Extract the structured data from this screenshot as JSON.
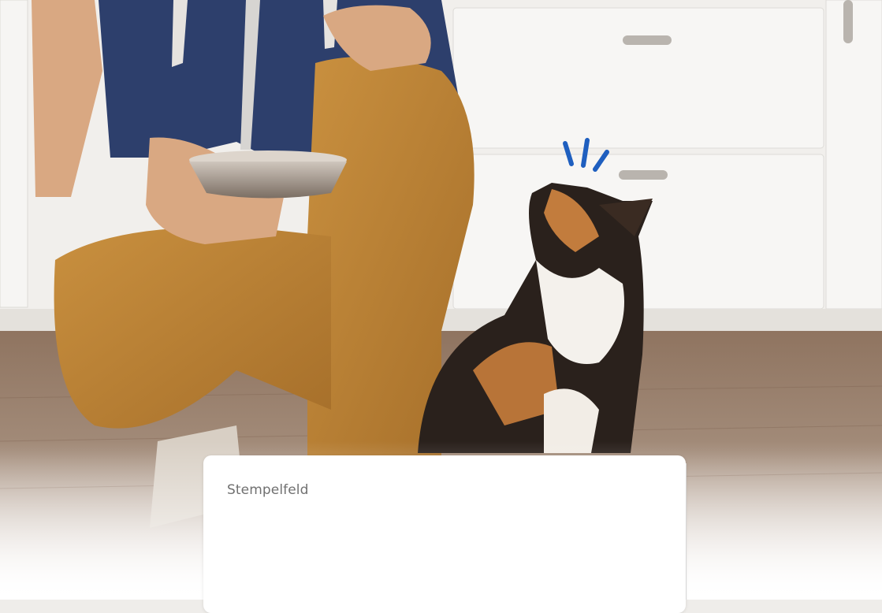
{
  "stamp_field": {
    "label": "Stempelfeld"
  },
  "hero_image": {
    "description_icon": "cat-looking-up-photo",
    "accent_color": "#1f5fbf"
  },
  "colors": {
    "cabinet": "#f4f3f1",
    "floor": "#8b6d58",
    "pants": "#c48b3c",
    "hoodie": "#2b3f6f",
    "card_background": "#ffffff"
  }
}
